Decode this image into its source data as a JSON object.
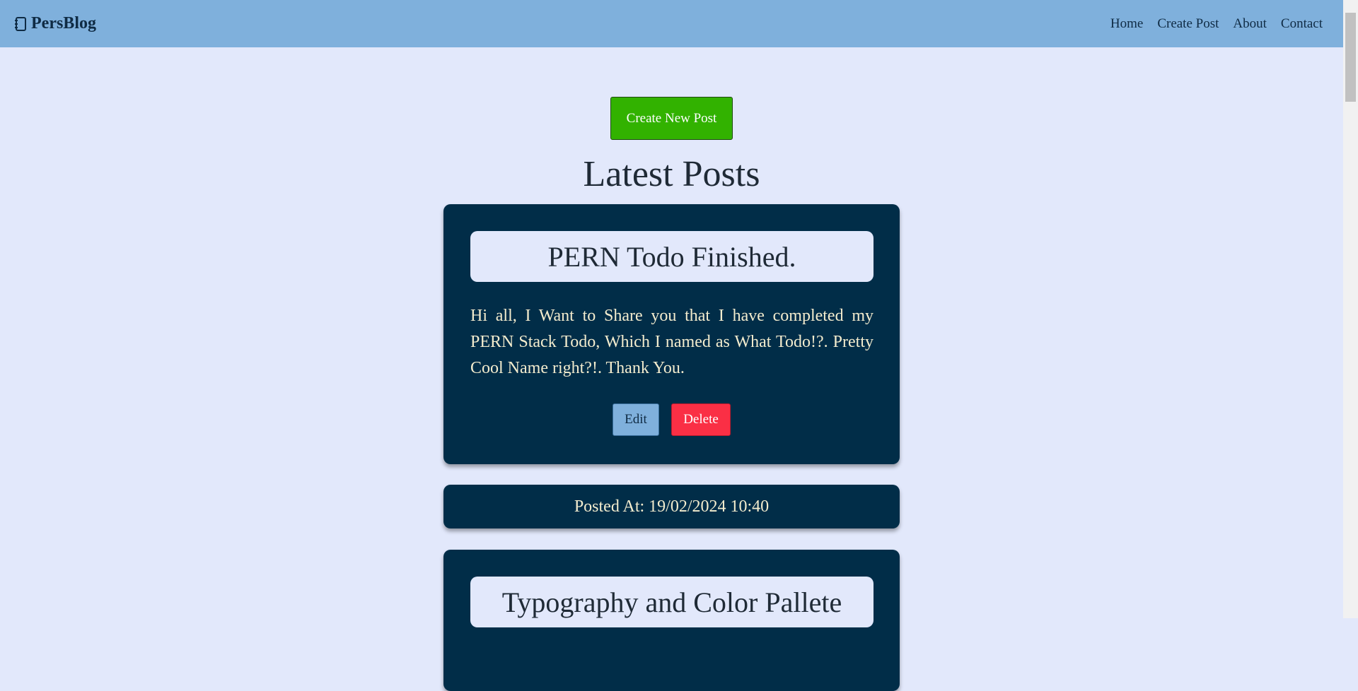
{
  "navbar": {
    "brand_icon": "notebook-icon",
    "brand": "PersBlog",
    "links": [
      "Home",
      "Create Post",
      "About",
      "Contact"
    ]
  },
  "main": {
    "create_button": "Create New Post",
    "section_title": "Latest Posts",
    "posts": [
      {
        "title": "PERN Todo Finished.",
        "body": "Hi all, I Want to Share you that I have completed my PERN Stack Todo, Which I named as What Todo!?. Pretty Cool Name right?!. Thank You.",
        "edit_label": "Edit",
        "delete_label": "Delete",
        "posted_at": "Posted At: 19/02/2024 10:40"
      },
      {
        "title": "Typography and Color Pallete"
      }
    ]
  },
  "colors": {
    "navbar_bg": "#7fb0dc",
    "page_bg": "#e2e8fb",
    "card_bg": "#012d48",
    "create_button": "#32b200",
    "delete_button": "#fa2f45",
    "edit_button": "#7fb0dc",
    "card_text": "#f3ecce"
  }
}
